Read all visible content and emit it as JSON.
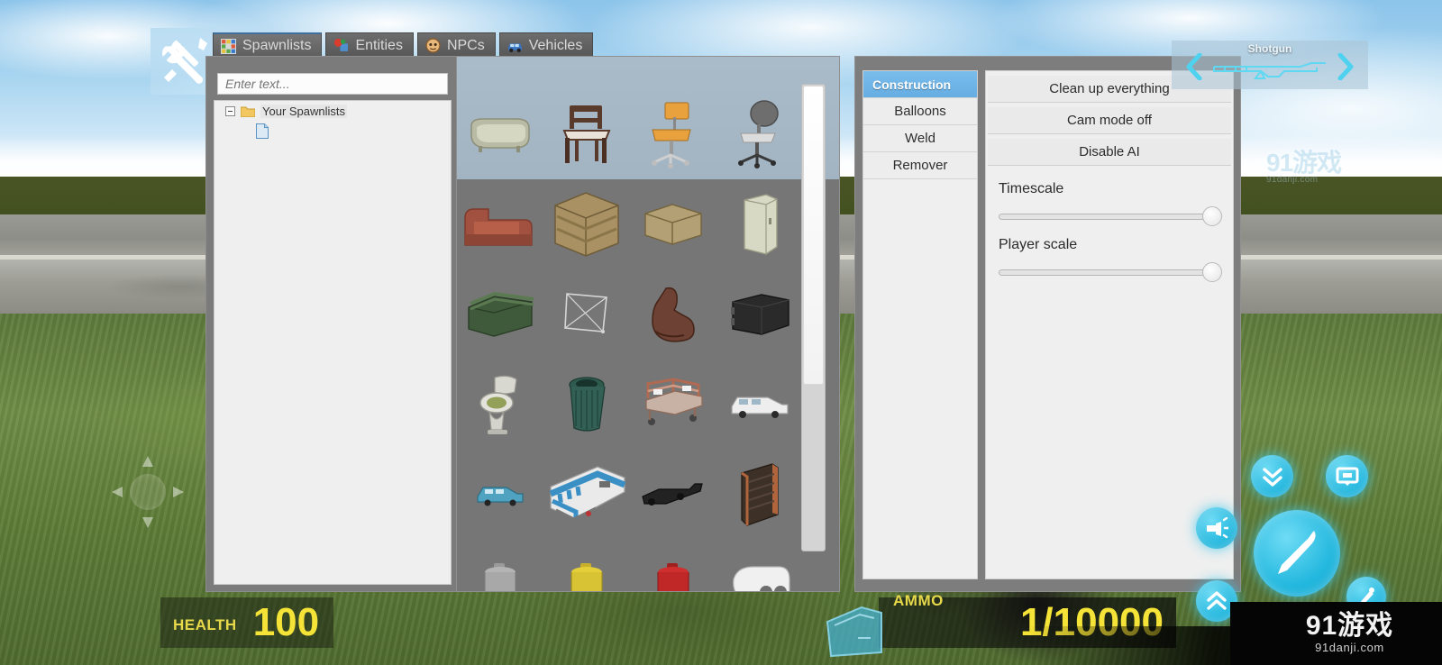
{
  "app": {
    "tool_icon": "wrench-screwdriver-icon"
  },
  "tabs": [
    {
      "label": "Spawnlists",
      "icon": "grid-icon",
      "active": true
    },
    {
      "label": "Entities",
      "icon": "entities-icon",
      "active": false
    },
    {
      "label": "NPCs",
      "icon": "npc-face-icon",
      "active": false
    },
    {
      "label": "Vehicles",
      "icon": "car-icon",
      "active": false
    }
  ],
  "spawnlists": {
    "search_placeholder": "Enter text...",
    "search_value": "",
    "tree": {
      "root_label": "Your Spawnlists",
      "expanded": true,
      "child_icon": "document-icon"
    }
  },
  "spawn_grid": {
    "scroll_thumb_position": "top",
    "rows": [
      [
        {
          "name": "bathtub"
        },
        {
          "name": "wooden-chair"
        },
        {
          "name": "orange-office-chair"
        },
        {
          "name": "grey-office-chair"
        }
      ],
      [
        {
          "name": "red-couch"
        },
        {
          "name": "large-wooden-crate"
        },
        {
          "name": "small-wooden-crate"
        },
        {
          "name": "metal-locker"
        }
      ],
      [
        {
          "name": "green-dumpster"
        },
        {
          "name": "wire-frame-barrier"
        },
        {
          "name": "leather-boot"
        },
        {
          "name": "black-case"
        }
      ],
      [
        {
          "name": "toilet"
        },
        {
          "name": "green-trash-can"
        },
        {
          "name": "hospital-bed-cart"
        },
        {
          "name": "white-van"
        }
      ],
      [
        {
          "name": "blue-minivan"
        },
        {
          "name": "train-car"
        },
        {
          "name": "black-flatbed-trailer"
        },
        {
          "name": "brick-wall-panel"
        }
      ],
      [
        {
          "name": "blue-gas-canister"
        },
        {
          "name": "yellow-gas-canister"
        },
        {
          "name": "red-gas-canister"
        },
        {
          "name": "white-machine-prop"
        }
      ]
    ],
    "touch_indicator_dots": 5
  },
  "tool_panel": {
    "tools": [
      {
        "label": "Construction",
        "selected": true
      },
      {
        "label": "Balloons",
        "selected": false
      },
      {
        "label": "Weld",
        "selected": false
      },
      {
        "label": "Remover",
        "selected": false
      }
    ],
    "buttons": [
      {
        "label": "Clean up everything"
      },
      {
        "label": "Cam mode off"
      },
      {
        "label": "Disable AI"
      }
    ],
    "sliders": [
      {
        "label": "Timescale",
        "percent": 100
      },
      {
        "label": "Player scale",
        "percent": 100
      }
    ]
  },
  "weapon_selector": {
    "name": "Shotgun",
    "prev_icon": "chevron-left-icon",
    "next_icon": "chevron-right-icon",
    "weapon_icon": "shotgun-outline-icon"
  },
  "hud": {
    "health_label": "HEALTH",
    "health_value": "100",
    "ammo_label": "AMMO",
    "ammo_value": "1/10000",
    "accent_color": "#f5e337"
  },
  "touch_controls": {
    "move_pad": "dpad-joystick",
    "buttons": [
      {
        "name": "crouch-button",
        "icon": "double-chevron-down-icon"
      },
      {
        "name": "chat-button",
        "icon": "speech-screen-icon"
      },
      {
        "name": "attack-button",
        "icon": "knife-slash-icon"
      },
      {
        "name": "flashlight-button",
        "icon": "flashlight-icon"
      },
      {
        "name": "jump-button",
        "icon": "double-chevron-up-icon"
      },
      {
        "name": "reload-button",
        "icon": "reload-icon"
      }
    ],
    "accent_color": "#22b7de"
  },
  "watermark": {
    "main": "91游戏",
    "sub": "91danji.com"
  }
}
